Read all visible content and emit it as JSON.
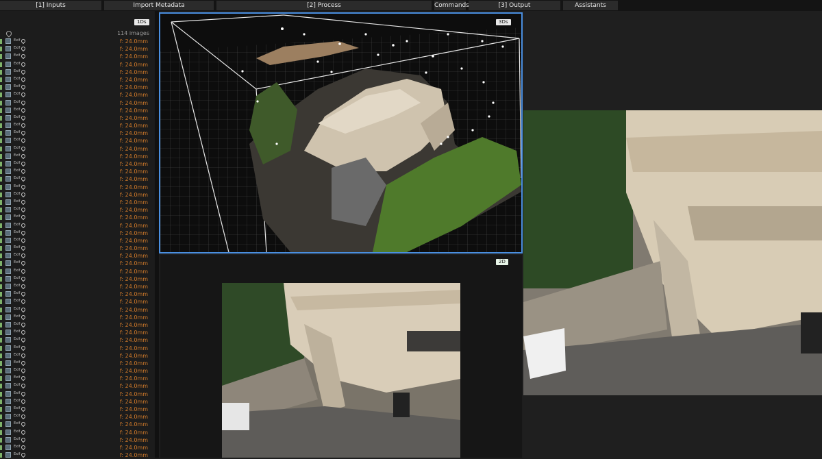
{
  "menu": {
    "inputs": "[1] Inputs",
    "import_metadata": "Import Metadata",
    "process": "[2] Process",
    "commands": "Commands",
    "output": "[3] Output",
    "assistants": "Assistants"
  },
  "images_panel": {
    "view_badge": "1Ds",
    "count": "114 images",
    "exif_label": "Exif",
    "focal_label": "f: 24.0mm",
    "rows": 55
  },
  "viewer3d": {
    "badge": "3Ds"
  },
  "viewer2d": {
    "badge": "2D"
  },
  "colors": {
    "accent": "#4a8fe0",
    "focal_text": "#d07a2a",
    "background": "#1e1e1e"
  }
}
